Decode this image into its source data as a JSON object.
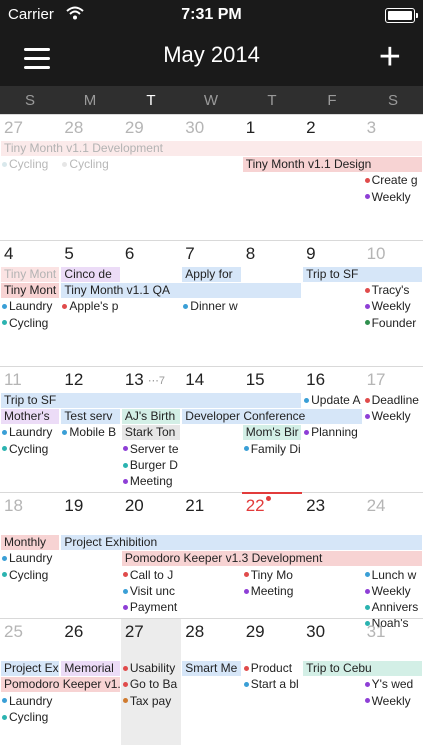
{
  "status_bar": {
    "carrier": "Carrier",
    "time": "7:31 PM",
    "battery_level": 1.0
  },
  "header": {
    "title": "May 2014",
    "menu_icon": "hamburger-menu-icon",
    "add_icon": "plus-icon",
    "add_glyph": "+"
  },
  "weekday_labels": [
    "S",
    "M",
    "T",
    "W",
    "T",
    "F",
    "S"
  ],
  "colors": {
    "header_bg": "#1a1a1a",
    "weekday_bar_bg": "#2f2f2f",
    "today": "#e23b3b",
    "blue_event": "#d6e6f8",
    "red_event": "#f7d3d3",
    "purple_event": "#ecdcf7",
    "green_event": "#d3efe6",
    "teal_event": "#d3efe6"
  },
  "weeks": [
    {
      "days": [
        {
          "label": "27",
          "style": "gray"
        },
        {
          "label": "28",
          "style": "gray"
        },
        {
          "label": "29",
          "style": "gray"
        },
        {
          "label": "30",
          "style": "gray"
        },
        {
          "label": "1"
        },
        {
          "label": "2"
        },
        {
          "label": "3",
          "style": "gray"
        }
      ],
      "bars": [
        {
          "text": "Tiny Month v1.1 Development",
          "col": 0,
          "span": 7,
          "row": 0,
          "color": "#fbeaea",
          "text_style": "gray"
        },
        {
          "text": "Tiny Month v1.1 Design",
          "col": 4,
          "span": 3,
          "row": 1,
          "color": "#f7d3d3"
        }
      ],
      "items": [
        {
          "text": "Cycling",
          "col": 0,
          "row": 1,
          "dot": "#d9e8ec",
          "text_style": "gray"
        },
        {
          "text": "Cycling",
          "col": 1,
          "row": 1,
          "dot": "#e6e6e6",
          "text_style": "gray"
        },
        {
          "text": "Create g",
          "col": 6,
          "row": 2,
          "dot": "#e04b4b"
        },
        {
          "text": "Weekly",
          "col": 6,
          "row": 3,
          "dot": "#8e3fd6"
        }
      ]
    },
    {
      "days": [
        {
          "label": "4"
        },
        {
          "label": "5"
        },
        {
          "label": "6"
        },
        {
          "label": "7"
        },
        {
          "label": "8"
        },
        {
          "label": "9"
        },
        {
          "label": "10",
          "style": "gray"
        }
      ],
      "bars": [
        {
          "text": "Tiny Mont",
          "col": 0,
          "span": 1,
          "row": 0,
          "color": "#fbe3e3",
          "text_style": "gray"
        },
        {
          "text": "Cinco de",
          "col": 1,
          "span": 1,
          "row": 0,
          "color": "#ecdcf7"
        },
        {
          "text": "Apply for",
          "col": 3,
          "span": 1,
          "row": 0,
          "color": "#d6e6f8"
        },
        {
          "text": "Trip to SF",
          "col": 5,
          "span": 2,
          "row": 0,
          "color": "#d6e6f8"
        },
        {
          "text": "Tiny Mont",
          "col": 0,
          "span": 1,
          "row": 1,
          "color": "#f7d3d3"
        },
        {
          "text": "Tiny Month v1.1 QA",
          "col": 1,
          "span": 4,
          "row": 1,
          "color": "#d6e6f8"
        }
      ],
      "items": [
        {
          "text": "Laundry",
          "col": 0,
          "row": 2,
          "dot": "#3a9fd6"
        },
        {
          "text": "Cycling",
          "col": 0,
          "row": 3,
          "dot": "#2bb3b0"
        },
        {
          "text": "Apple's p",
          "col": 1,
          "row": 2,
          "dot": "#e04b4b"
        },
        {
          "text": "Dinner w",
          "col": 3,
          "row": 2,
          "dot": "#3a9fd6"
        },
        {
          "text": "Tracy's",
          "col": 6,
          "row": 1,
          "dot": "#e04b4b"
        },
        {
          "text": "Weekly",
          "col": 6,
          "row": 2,
          "dot": "#8e3fd6"
        },
        {
          "text": "Founder",
          "col": 6,
          "row": 3,
          "dot": "#2f8f4e"
        }
      ]
    },
    {
      "days": [
        {
          "label": "11",
          "style": "gray"
        },
        {
          "label": "12"
        },
        {
          "label": "13",
          "more": "⋯7"
        },
        {
          "label": "14"
        },
        {
          "label": "15"
        },
        {
          "label": "16"
        },
        {
          "label": "17",
          "style": "gray"
        }
      ],
      "bars": [
        {
          "text": "Trip to SF",
          "col": 0,
          "span": 5,
          "row": 0,
          "color": "#d6e6f8"
        },
        {
          "text": "Mother's",
          "col": 0,
          "span": 1,
          "row": 1,
          "color": "#ecdcf7"
        },
        {
          "text": "Test serv",
          "col": 1,
          "span": 1,
          "row": 1,
          "color": "#d6e6f8"
        },
        {
          "text": "AJ's Birth",
          "col": 2,
          "span": 1,
          "row": 1,
          "color": "#d3efe6"
        },
        {
          "text": "Developer Conference",
          "col": 3,
          "span": 3,
          "row": 1,
          "color": "#d6e6f8"
        },
        {
          "text": "Stark Ton",
          "col": 2,
          "span": 1,
          "row": 2,
          "color": "#e6e6e6"
        },
        {
          "text": "Mom's Bir",
          "col": 4,
          "span": 1,
          "row": 2,
          "color": "#d3efe6"
        }
      ],
      "items": [
        {
          "text": "Update A",
          "col": 5,
          "row": 0,
          "dot": "#3a9fd6"
        },
        {
          "text": "Deadline",
          "col": 6,
          "row": 0,
          "dot": "#e04b4b"
        },
        {
          "text": "Weekly",
          "col": 6,
          "row": 1,
          "dot": "#8e3fd6"
        },
        {
          "text": "Laundry",
          "col": 0,
          "row": 2,
          "dot": "#3a9fd6"
        },
        {
          "text": "Cycling",
          "col": 0,
          "row": 3,
          "dot": "#2bb3b0"
        },
        {
          "text": "Mobile B",
          "col": 1,
          "row": 2,
          "dot": "#3a9fd6"
        },
        {
          "text": "Server te",
          "col": 2,
          "row": 3,
          "dot": "#8e3fd6"
        },
        {
          "text": "Burger D",
          "col": 2,
          "row": 4,
          "dot": "#2bb3b0"
        },
        {
          "text": "Meeting",
          "col": 2,
          "row": 5,
          "dot": "#8e3fd6"
        },
        {
          "text": "Family Di",
          "col": 4,
          "row": 3,
          "dot": "#3a9fd6"
        },
        {
          "text": "Planning",
          "col": 5,
          "row": 2,
          "dot": "#8e3fd6"
        }
      ]
    },
    {
      "days": [
        {
          "label": "18",
          "style": "gray"
        },
        {
          "label": "19"
        },
        {
          "label": "20"
        },
        {
          "label": "21"
        },
        {
          "label": "22",
          "style": "red",
          "today": true
        },
        {
          "label": "23"
        },
        {
          "label": "24",
          "style": "gray"
        }
      ],
      "bars": [
        {
          "text": "Monthly",
          "col": 0,
          "span": 1,
          "row": 1,
          "color": "#f7d3d3"
        },
        {
          "text": "Project Exhibition",
          "col": 1,
          "span": 6,
          "row": 1,
          "color": "#d6e6f8"
        },
        {
          "text": "Pomodoro Keeper v1.3 Development",
          "col": 2,
          "span": 5,
          "row": 2,
          "color": "#f7d3d3"
        }
      ],
      "items": [
        {
          "text": "Laundry",
          "col": 0,
          "row": 2,
          "dot": "#3a9fd6"
        },
        {
          "text": "Cycling",
          "col": 0,
          "row": 3,
          "dot": "#2bb3b0"
        },
        {
          "text": "Call to J",
          "col": 2,
          "row": 3,
          "dot": "#e04b4b"
        },
        {
          "text": "Visit unc",
          "col": 2,
          "row": 4,
          "dot": "#3a9fd6"
        },
        {
          "text": "Payment",
          "col": 2,
          "row": 5,
          "dot": "#8e3fd6"
        },
        {
          "text": "Tiny Mo",
          "col": 4,
          "row": 3,
          "dot": "#e04b4b"
        },
        {
          "text": "Meeting",
          "col": 4,
          "row": 4,
          "dot": "#8e3fd6"
        },
        {
          "text": "Lunch w",
          "col": 6,
          "row": 3,
          "dot": "#3a9fd6"
        },
        {
          "text": "Weekly",
          "col": 6,
          "row": 4,
          "dot": "#8e3fd6"
        },
        {
          "text": "Annivers",
          "col": 6,
          "row": 5,
          "dot": "#2bb3b0"
        },
        {
          "text": "Noah's",
          "col": 6,
          "row": 6,
          "dot": "#2bb3b0"
        }
      ]
    },
    {
      "days": [
        {
          "label": "25",
          "style": "gray"
        },
        {
          "label": "26"
        },
        {
          "label": "27",
          "shaded": true
        },
        {
          "label": "28"
        },
        {
          "label": "29"
        },
        {
          "label": "30"
        },
        {
          "label": "31",
          "style": "gray"
        }
      ],
      "bars": [
        {
          "text": "Project Ex",
          "col": 0,
          "span": 1,
          "row": 1,
          "color": "#d6e6f8"
        },
        {
          "text": "Memorial",
          "col": 1,
          "span": 1,
          "row": 1,
          "color": "#ecdcf7"
        },
        {
          "text": "Smart Me",
          "col": 3,
          "span": 1,
          "row": 1,
          "color": "#d6e6f8"
        },
        {
          "text": "Trip to Cebu",
          "col": 5,
          "span": 2,
          "row": 1,
          "color": "#d3efe6"
        },
        {
          "text": "Pomodoro Keeper v1.",
          "col": 0,
          "span": 2,
          "row": 2,
          "color": "#f7d3d3"
        }
      ],
      "items": [
        {
          "text": "Usability",
          "col": 2,
          "row": 1,
          "dot": "#e04b4b"
        },
        {
          "text": "Go to Ba",
          "col": 2,
          "row": 2,
          "dot": "#e04b4b"
        },
        {
          "text": "Tax pay",
          "col": 2,
          "row": 3,
          "dot": "#d07a2e"
        },
        {
          "text": "Product",
          "col": 4,
          "row": 1,
          "dot": "#e04b4b"
        },
        {
          "text": "Start a bl",
          "col": 4,
          "row": 2,
          "dot": "#3a9fd6"
        },
        {
          "text": "Y's wed",
          "col": 6,
          "row": 2,
          "dot": "#8e3fd6"
        },
        {
          "text": "Weekly",
          "col": 6,
          "row": 3,
          "dot": "#8e3fd6"
        },
        {
          "text": "Laundry",
          "col": 0,
          "row": 3,
          "dot": "#3a9fd6"
        },
        {
          "text": "Cycling",
          "col": 0,
          "row": 4,
          "dot": "#2bb3b0"
        }
      ]
    }
  ]
}
